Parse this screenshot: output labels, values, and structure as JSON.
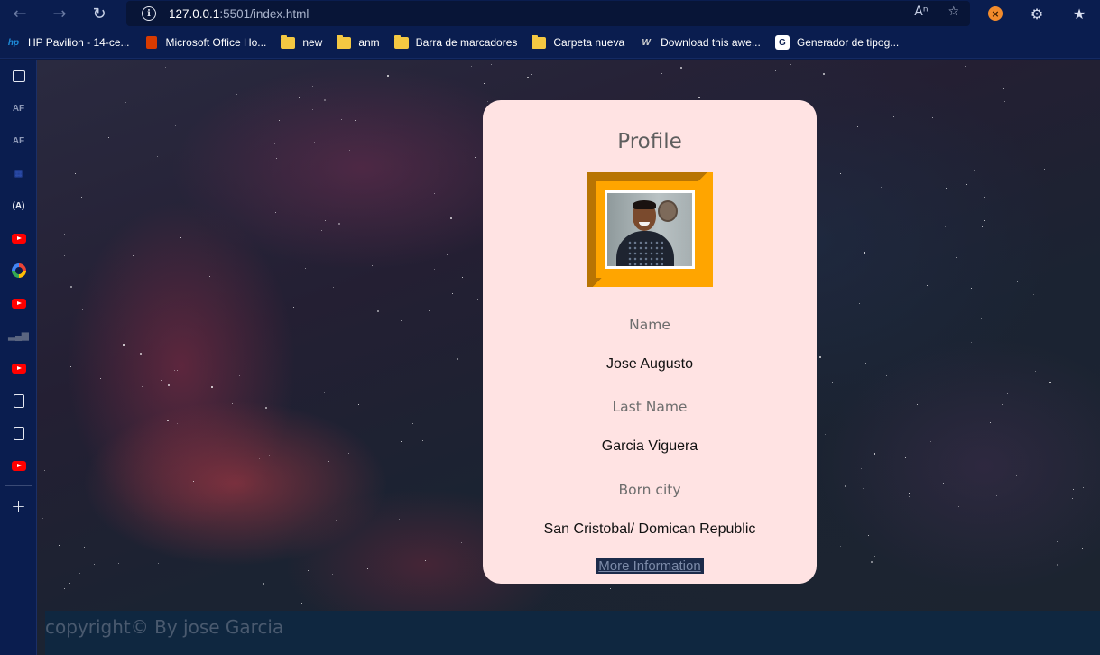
{
  "browser": {
    "url_host": "127.0.0.1",
    "url_rest": ":5501/index.html"
  },
  "bookmarks": [
    {
      "label": "HP Pavilion - 14-ce...",
      "icon": "hp-icon"
    },
    {
      "label": "Microsoft Office Ho...",
      "icon": "office-icon"
    },
    {
      "label": "new",
      "icon": "folder-icon"
    },
    {
      "label": "anm",
      "icon": "folder-icon"
    },
    {
      "label": "Barra de marcadores",
      "icon": "folder-icon"
    },
    {
      "label": "Carpeta nueva",
      "icon": "folder-icon"
    },
    {
      "label": "Download this awe...",
      "icon": "w-icon"
    },
    {
      "label": "Generador de tipog...",
      "icon": "generator-icon"
    }
  ],
  "sidebar": {
    "items": [
      "collections-icon",
      "af-icon",
      "af-icon",
      "extension-icon",
      "a-icon",
      "youtube-icon",
      "google-icon",
      "youtube-icon",
      "chart-icon",
      "youtube-icon",
      "document-icon",
      "document-icon",
      "youtube-icon"
    ]
  },
  "profile": {
    "title": "Profile",
    "name_label": "Name",
    "name_value": "Jose Augusto",
    "last_name_label": "Last Name",
    "last_name_value": "Garcia Viguera",
    "born_city_label": "Born city",
    "born_city_value": "San Cristobal/ Domican Republic",
    "more_link": "More Information"
  },
  "footer": {
    "copyright": "copyright© By jose Garcia"
  },
  "colors": {
    "card_background": "#ffe3e3",
    "frame_orange": "#ffa500",
    "frame_dark": "#b87403",
    "browser_chrome": "#0a1d4f"
  }
}
